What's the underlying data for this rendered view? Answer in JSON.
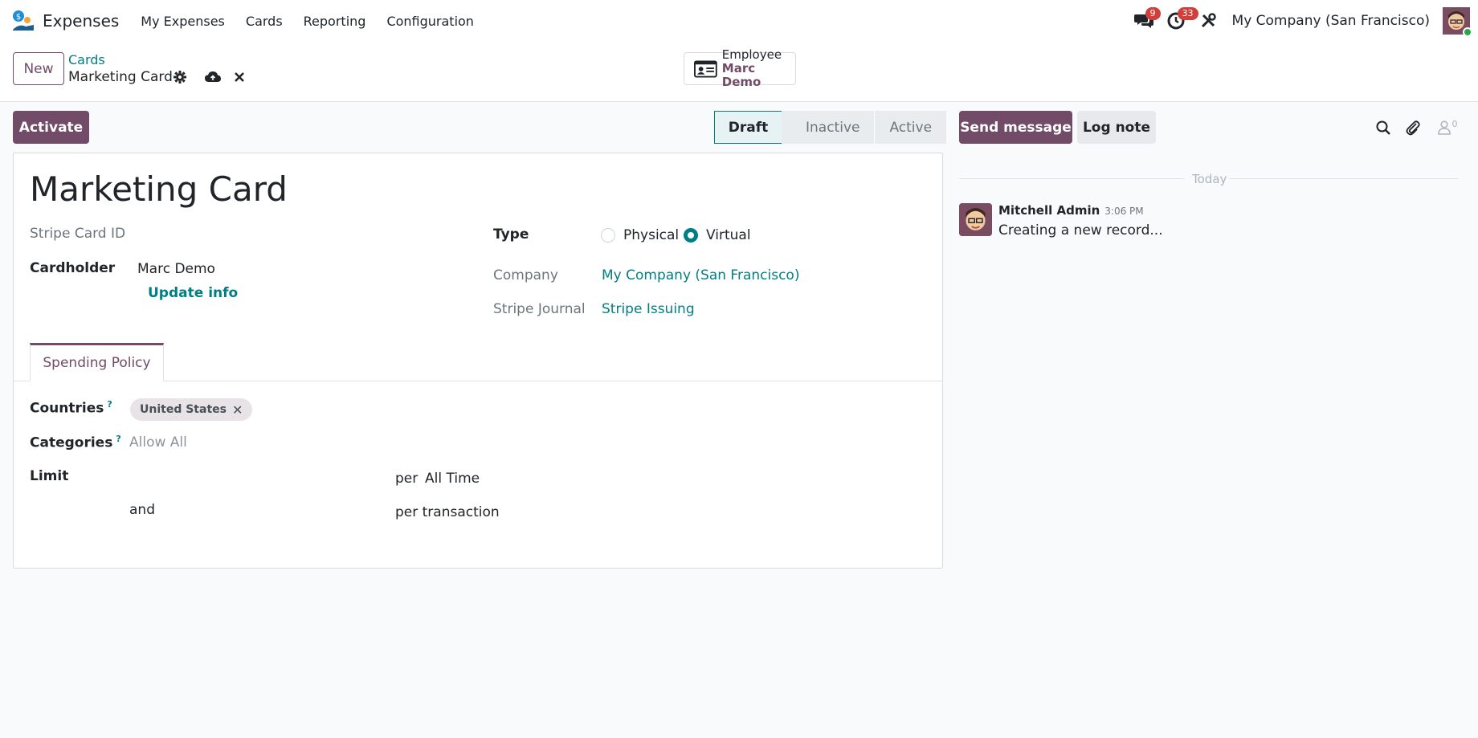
{
  "navbar": {
    "app_name": "Expenses",
    "menu": [
      "My Expenses",
      "Cards",
      "Reporting",
      "Configuration"
    ],
    "messages_count": "9",
    "activities_count": "33",
    "company": "My Company (San Francisco)"
  },
  "control": {
    "new_label": "New",
    "breadcrumb": "Cards",
    "record_title": "Marketing Card",
    "smart_button": {
      "label": "Employee",
      "value": "Marc Demo"
    }
  },
  "statusbar": {
    "action_label": "Activate",
    "stages": [
      "Draft",
      "Inactive",
      "Active"
    ],
    "current": "Draft"
  },
  "form": {
    "name": "Marketing Card",
    "stripe_card_id_label": "Stripe Card ID",
    "cardholder_label": "Cardholder",
    "cardholder_value": "Marc Demo",
    "update_info_label": "Update info",
    "type_label": "Type",
    "type_options": [
      "Physical",
      "Virtual"
    ],
    "type_selected": "Virtual",
    "company_label": "Company",
    "company_value": "My Company (San Francisco)",
    "journal_label": "Stripe Journal",
    "journal_value": "Stripe Issuing",
    "tab_label": "Spending Policy",
    "countries_label": "Countries",
    "help_mark": "?",
    "countries_tag": "United States",
    "categories_label": "Categories",
    "categories_placeholder": "Allow All",
    "limit_label": "Limit",
    "per_label": "per",
    "period_value": "All Time",
    "and_label": "and",
    "per_transaction_label": "per transaction"
  },
  "chatter": {
    "send_label": "Send message",
    "log_label": "Log note",
    "followers_count": "0",
    "date_separator": "Today",
    "message": {
      "author": "Mitchell Admin",
      "time": "3:06 PM",
      "body": "Creating a new record..."
    }
  },
  "colors": {
    "brand": "#714b67",
    "link": "#017e84",
    "badge": "#d23f3a"
  }
}
